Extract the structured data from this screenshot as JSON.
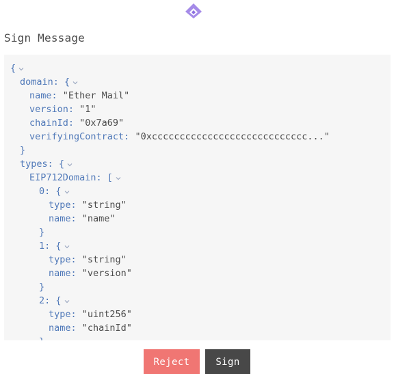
{
  "app": {
    "logo_icon": "hexagon-chevron-logo-icon",
    "accent_color": "#9b7ae6"
  },
  "header": {
    "title": "Sign Message"
  },
  "message": {
    "lines": [
      {
        "indent": 0,
        "parts": [
          {
            "t": "{",
            "c": "p"
          }
        ],
        "chevron": true
      },
      {
        "indent": 1,
        "parts": [
          {
            "t": "domain: {",
            "c": "k"
          }
        ],
        "chevron": true
      },
      {
        "indent": 2,
        "parts": [
          {
            "t": "name: ",
            "c": "k"
          },
          {
            "t": "\"Ether Mail\"",
            "c": "s"
          }
        ],
        "chevron": false
      },
      {
        "indent": 2,
        "parts": [
          {
            "t": "version: ",
            "c": "k"
          },
          {
            "t": "\"1\"",
            "c": "s"
          }
        ],
        "chevron": false
      },
      {
        "indent": 2,
        "parts": [
          {
            "t": "chainId: ",
            "c": "k"
          },
          {
            "t": "\"0x7a69\"",
            "c": "s"
          }
        ],
        "chevron": false
      },
      {
        "indent": 2,
        "parts": [
          {
            "t": "verifyingContract: ",
            "c": "k"
          },
          {
            "t": "\"0xcccccccccccccccccccccccccccc...\"",
            "c": "s"
          }
        ],
        "chevron": false
      },
      {
        "indent": 1,
        "parts": [
          {
            "t": "}",
            "c": "p"
          }
        ],
        "chevron": false
      },
      {
        "indent": 1,
        "parts": [
          {
            "t": "types: {",
            "c": "k"
          }
        ],
        "chevron": true
      },
      {
        "indent": 2,
        "parts": [
          {
            "t": "EIP712Domain: [",
            "c": "k"
          }
        ],
        "chevron": true
      },
      {
        "indent": 3,
        "parts": [
          {
            "t": "0: {",
            "c": "k"
          }
        ],
        "chevron": true
      },
      {
        "indent": 4,
        "parts": [
          {
            "t": "type: ",
            "c": "k"
          },
          {
            "t": "\"string\"",
            "c": "s"
          }
        ],
        "chevron": false
      },
      {
        "indent": 4,
        "parts": [
          {
            "t": "name: ",
            "c": "k"
          },
          {
            "t": "\"name\"",
            "c": "s"
          }
        ],
        "chevron": false
      },
      {
        "indent": 3,
        "parts": [
          {
            "t": "}",
            "c": "p"
          }
        ],
        "chevron": false
      },
      {
        "indent": 3,
        "parts": [
          {
            "t": "1: {",
            "c": "k"
          }
        ],
        "chevron": true
      },
      {
        "indent": 4,
        "parts": [
          {
            "t": "type: ",
            "c": "k"
          },
          {
            "t": "\"string\"",
            "c": "s"
          }
        ],
        "chevron": false
      },
      {
        "indent": 4,
        "parts": [
          {
            "t": "name: ",
            "c": "k"
          },
          {
            "t": "\"version\"",
            "c": "s"
          }
        ],
        "chevron": false
      },
      {
        "indent": 3,
        "parts": [
          {
            "t": "}",
            "c": "p"
          }
        ],
        "chevron": false
      },
      {
        "indent": 3,
        "parts": [
          {
            "t": "2: {",
            "c": "k"
          }
        ],
        "chevron": true
      },
      {
        "indent": 4,
        "parts": [
          {
            "t": "type: ",
            "c": "k"
          },
          {
            "t": "\"uint256\"",
            "c": "s"
          }
        ],
        "chevron": false
      },
      {
        "indent": 4,
        "parts": [
          {
            "t": "name: ",
            "c": "k"
          },
          {
            "t": "\"chainId\"",
            "c": "s"
          }
        ],
        "chevron": false
      },
      {
        "indent": 3,
        "parts": [
          {
            "t": "}",
            "c": "p"
          }
        ],
        "chevron": false
      }
    ]
  },
  "actions": {
    "reject_label": "Reject",
    "sign_label": "Sign",
    "reject_color": "#f07673",
    "sign_color": "#484848"
  }
}
